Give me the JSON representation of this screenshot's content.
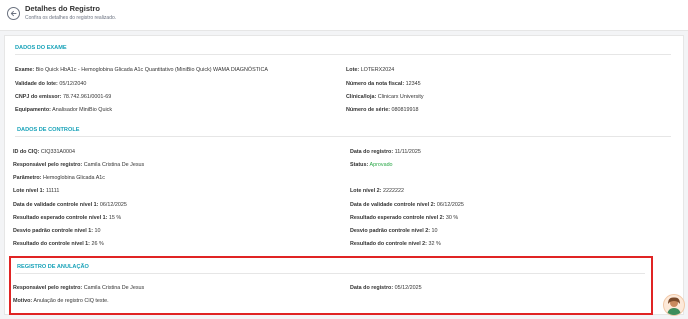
{
  "header": {
    "title": "Detalhes do Registro",
    "subtitle": "Confira os detalhes do registro realizado."
  },
  "sections": {
    "exame": {
      "title": "DADOS DO EXAME"
    },
    "controle": {
      "title": "DADOS DE CONTROLE"
    },
    "anulacao": {
      "title": "REGISTRO DE ANULAÇÃO"
    }
  },
  "exame": {
    "exame": {
      "label": "Exame:",
      "value": "Bio Quick HbA1c - Hemoglobina Glicada A1c Quantitativo (MiniBio Quick) WAMA DIAGNÓSTICA"
    },
    "lote": {
      "label": "Lote:",
      "value": "LOTERX2024"
    },
    "validade": {
      "label": "Validade do lote:",
      "value": "05/12/2040"
    },
    "nota": {
      "label": "Número da nota fiscal:",
      "value": "12345"
    },
    "cnpj": {
      "label": "CNPJ do emissor:",
      "value": "78.742.961/0001-69"
    },
    "clinica": {
      "label": "Clínica/loja:",
      "value": "Clinicarx University"
    },
    "equipamento": {
      "label": "Equipamento:",
      "value": "Analisador MiniBio Quick"
    },
    "serie": {
      "label": "Número de série:",
      "value": "080819918"
    }
  },
  "controle": {
    "id": {
      "label": "ID do CIQ:",
      "value": "CIQ331A0004"
    },
    "data": {
      "label": "Data do registro:",
      "value": "11/11/2025"
    },
    "responsavel": {
      "label": "Responsável pelo registro:",
      "value": "Camila Cristina De Jesus"
    },
    "status": {
      "label": "Status:",
      "value": "Aprovado"
    },
    "parametro": {
      "label": "Parâmetro:",
      "value": "Hemoglobina Glicada A1c"
    },
    "lote1": {
      "label": "Lote nível 1:",
      "value": "11111"
    },
    "lote2": {
      "label": "Lote nível 2:",
      "value": "2222222"
    },
    "validade1": {
      "label": "Data de validade controle nível 1:",
      "value": "06/12/2025"
    },
    "validade2": {
      "label": "Data de validade controle nível 2:",
      "value": "06/12/2025"
    },
    "esperado1": {
      "label": "Resultado esperado controle nível 1:",
      "value": "15 %"
    },
    "esperado2": {
      "label": "Resultado esperado controle nível 2:",
      "value": "30 %"
    },
    "desvio1": {
      "label": "Desvio padrão controle nível 1:",
      "value": "10"
    },
    "desvio2": {
      "label": "Desvio padrão controle nível 2:",
      "value": "10"
    },
    "resultado1": {
      "label": "Resultado do controle nível 1:",
      "value": "26 %"
    },
    "resultado2": {
      "label": "Resultado do controle nível 2:",
      "value": "32 %"
    }
  },
  "anulacao": {
    "responsavel": {
      "label": "Responsável pelo registro:",
      "value": "Camila Cristina De Jesus"
    },
    "data": {
      "label": "Data do registro:",
      "value": "05/12/2025"
    },
    "motivo": {
      "label": "Motivo:",
      "value": "Anulação de registro CIQ teste."
    }
  },
  "colors": {
    "accent": "#17a2b8",
    "status_ok": "#28a745",
    "highlight_border": "#e02424"
  },
  "icons": {
    "back": "arrow-left-circle-icon",
    "avatar": "user-avatar-icon"
  }
}
